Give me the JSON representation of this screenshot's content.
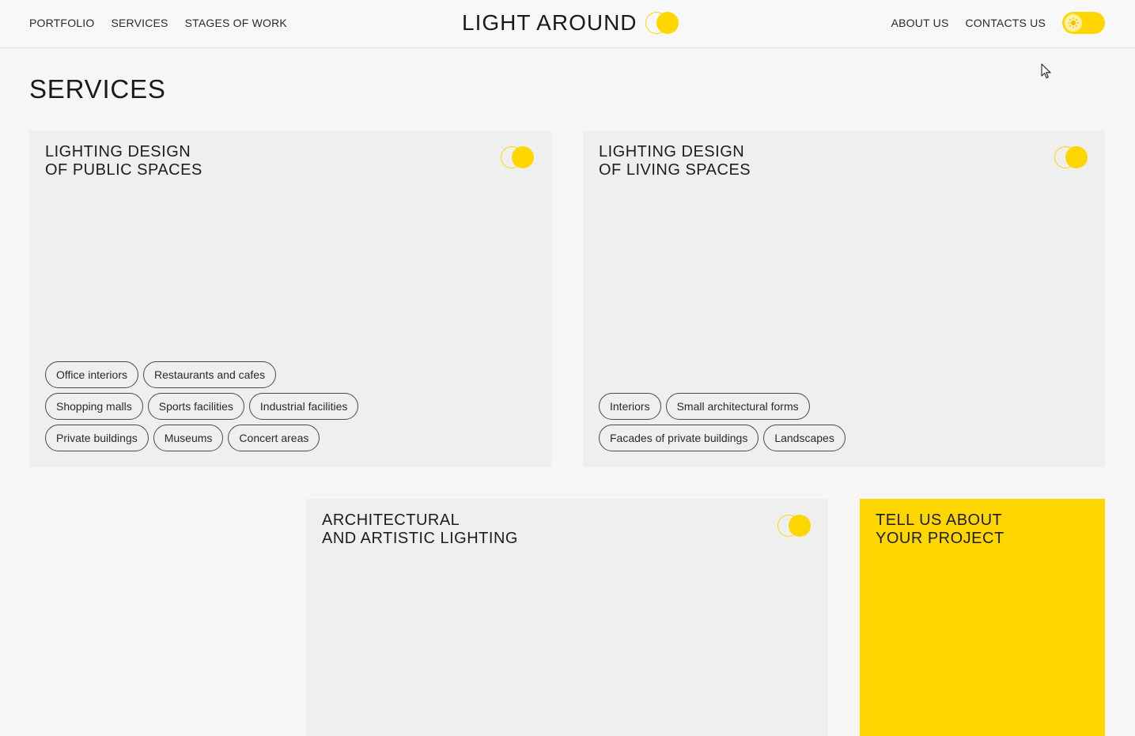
{
  "header": {
    "nav_left": [
      "PORTFOLIO",
      "SERVICES",
      "STAGES OF WORK"
    ],
    "logo_text": "LIGHT AROUND",
    "nav_right": [
      "ABOUT US",
      "CONTACTS US"
    ]
  },
  "page": {
    "title": "SERVICES"
  },
  "cards": {
    "public": {
      "title": "LIGHTING DESIGN\nOF PUBLIC SPACES",
      "tags": [
        [
          "Office interiors",
          "Restaurants and cafes"
        ],
        [
          "Shopping malls",
          "Sports facilities",
          "Industrial facilities"
        ],
        [
          "Private buildings",
          "Museums",
          "Concert areas"
        ]
      ]
    },
    "living": {
      "title": "LIGHTING DESIGN\nOF LIVING SPACES",
      "tags": [
        [
          "Interiors",
          "Small architectural forms"
        ],
        [
          "Facades of private buildings",
          "Landscapes"
        ]
      ]
    },
    "arch": {
      "title": "ARCHITECTURAL\nAND ARTISTIC LIGHTING"
    },
    "cta": {
      "title": "TELL US ABOUT\nYOUR PROJECT"
    }
  },
  "colors": {
    "accent": "#ffd600",
    "background": "#f6f6f6",
    "card": "#efefef"
  },
  "icons": {
    "logo_mark": "logo-mark-icon",
    "theme_toggle": "sun-icon",
    "cursor": "cursor-icon"
  }
}
